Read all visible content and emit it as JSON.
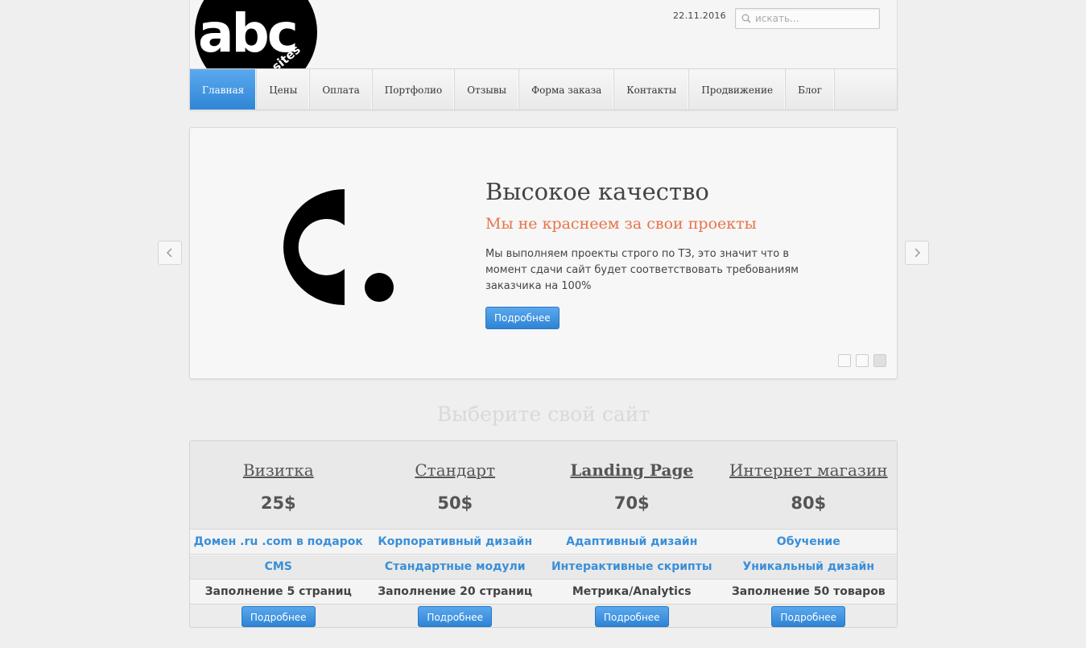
{
  "header": {
    "date": "22.11.2016",
    "search_placeholder": "искать...",
    "logo_text": "abc",
    "logo_subtext": "sites"
  },
  "nav": {
    "items": [
      {
        "label": "Главная",
        "active": true
      },
      {
        "label": "Цены"
      },
      {
        "label": "Оплата"
      },
      {
        "label": "Портфолио"
      },
      {
        "label": "Отзывы"
      },
      {
        "label": "Форма заказа"
      },
      {
        "label": "Контакты"
      },
      {
        "label": "Продвижение"
      },
      {
        "label": "Блог"
      }
    ]
  },
  "slider": {
    "title": "Высокое качество",
    "subtitle": "Мы не краснеем за свои проекты",
    "text": "Мы выполняем проекты строго по ТЗ, это значит что в момент сдачи сайт будет соответствовать требованиям заказчика на 100%",
    "button": "Подробнее",
    "image_icon": "c-dot-logo",
    "pages": 3,
    "active_page": 3
  },
  "pricing": {
    "title": "Выберите свой сайт",
    "plans": [
      {
        "name": "Визитка",
        "price": "25$",
        "button": "Подробнее"
      },
      {
        "name": "Стандарт",
        "price": "50$",
        "button": "Подробнее"
      },
      {
        "name": "Landing Page",
        "price": "70$",
        "button": "Подробнее"
      },
      {
        "name": "Интернет магазин",
        "price": "80$",
        "button": "Подробнее"
      }
    ],
    "rows": [
      [
        "Домен .ru .com в подарок",
        "Корпоративный дизайн",
        "Адаптивный дизайн",
        "Обучение"
      ],
      [
        "CMS",
        "Стандартные модули",
        "Интерактивные скрипты",
        "Уникальный дизайн"
      ],
      [
        "Заполнение 5 страниц",
        "Заполнение 20 страниц",
        "Метрика/Analytics",
        "Заполнение 50 товаров"
      ]
    ]
  },
  "colors": {
    "accent": "#3a8fd8",
    "subtitle": "#e8734a",
    "background": "#efefef"
  }
}
